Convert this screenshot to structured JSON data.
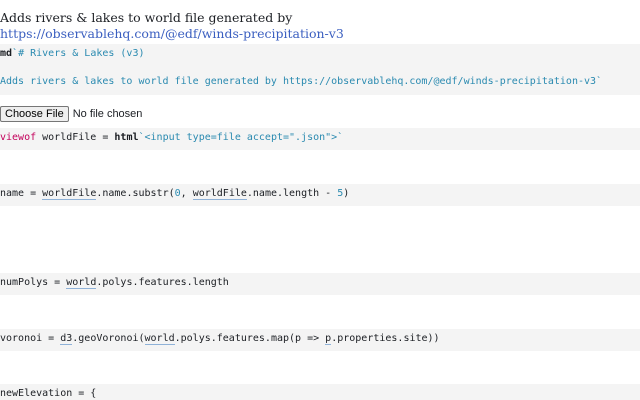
{
  "intro": {
    "text": "Adds rivers & lakes to world file generated by",
    "link": "https://observablehq.com/@edf/winds-precipitation-v3"
  },
  "md_cell": {
    "tag": "md",
    "line1": "`# Rivers & Lakes (v3)",
    "line2": "Adds rivers & lakes to world file generated by https://observablehq.com/@edf/winds-precipitation-v3`"
  },
  "file_input": {
    "button_label": "Choose File",
    "status": "No file chosen"
  },
  "cells": {
    "worldfile": {
      "kw": "viewof",
      "name": " worldFile = ",
      "tag": "html",
      "str": "`<input type=file accept=\".json\">`"
    },
    "name_cell": {
      "lhs": "name = ",
      "ref1": "worldFile",
      "mid1": ".name.substr(",
      "num1": "0",
      "mid2": ", ",
      "ref2": "worldFile",
      "mid3": ".name.length - ",
      "num2": "5",
      "end": ")"
    },
    "numpolys": {
      "lhs": "numPolys = ",
      "ref": "world",
      "rest": ".polys.features.length"
    },
    "voronoi": {
      "lhs": "voronoi = ",
      "ref1": "d3",
      "mid1": ".geoVoronoi(",
      "ref2": "world",
      "mid2": ".polys.features.map(",
      "param": "p",
      "arrow": " => ",
      "ref3": "p",
      "end": ".properties.site))"
    },
    "newelevation": {
      "text": "newElevation = {"
    }
  }
}
